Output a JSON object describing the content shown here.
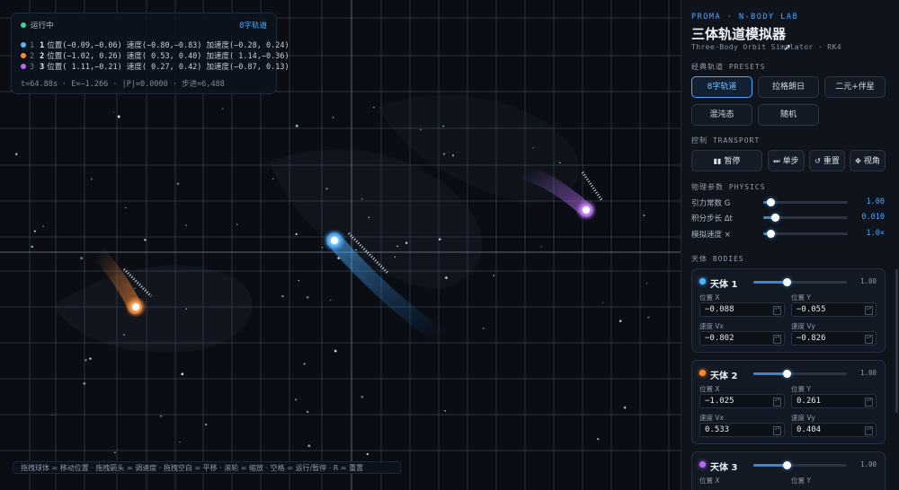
{
  "hud": {
    "status": "运行中",
    "preset": "8字轨道",
    "bodies": [
      {
        "idx": "1",
        "color": "#4fb6ff",
        "text": "位置(−0.09,−0.06) 速度(−0.80,−0.83) 加速度(−0.28, 0.24)"
      },
      {
        "idx": "2",
        "color": "#ff8a2e",
        "text": "位置(−1.02, 0.26) 速度( 0.53, 0.40) 加速度( 1.14,−0.36)"
      },
      {
        "idx": "3",
        "color": "#b56cf2",
        "text": "位置( 1.11,−0.21) 速度( 0.27, 0.42) 加速度(−0.87, 0.13)"
      }
    ],
    "stats": "t=64.88s · E=−1.266 · |P|=0.0000 · 步进=6,488"
  },
  "hint": "拖拽球体 = 移动位置 · 拖拽箭头 = 调速度 · 拖拽空白 = 平移 · 滚轮 = 缩放 · 空格 = 运行/暂停 · R = 重置",
  "panel": {
    "brand": "PROMA · N-BODY LAB",
    "title": "三体轨道模拟器",
    "subtitle": "Three-Body Orbit Simulator · RK4",
    "presets_label": "经典轨道 PRESETS",
    "presets": [
      "8字轨道",
      "拉格朗日",
      "二元+伴星",
      "混沌态",
      "随机"
    ],
    "transport_label": "控制 TRANSPORT",
    "transport": [
      {
        "icon": "▮▮",
        "label": "暂停"
      },
      {
        "icon": "⏭",
        "label": "单步"
      },
      {
        "icon": "↺",
        "label": "重置"
      },
      {
        "icon": "✥",
        "label": "视角"
      }
    ],
    "physics_label": "物理参数 PHYSICS",
    "params": [
      {
        "label": "引力常数 G",
        "value": "1.00",
        "level": 0.05
      },
      {
        "label": "积分步长 Δt",
        "value": "0.010",
        "level": 0.1
      },
      {
        "label": "模拟速度 ×",
        "value": "1.0×",
        "level": 0.05
      }
    ],
    "bodies_label": "天体 BODIES",
    "bodies": [
      {
        "name": "天体 1",
        "color": "#4fb6ff",
        "mass": "1.00",
        "mass_level": 0.35,
        "pos_x_label": "位置 X",
        "pos_y_label": "位置 Y",
        "vel_x_label": "速度 Vx",
        "vel_y_label": "速度 Vy",
        "x": "−0.088",
        "y": "−0.055",
        "vx": "−0.802",
        "vy": "−0.826"
      },
      {
        "name": "天体 2",
        "color": "#ff8a2e",
        "mass": "1.00",
        "mass_level": 0.35,
        "pos_x_label": "位置 X",
        "pos_y_label": "位置 Y",
        "vel_x_label": "速度 Vx",
        "vel_y_label": "速度 Vy",
        "x": "−1.025",
        "y": "0.261",
        "vx": "0.533",
        "vy": "0.404"
      },
      {
        "name": "天体 3",
        "color": "#b56cf2",
        "mass": "1.00",
        "mass_level": 0.35,
        "pos_x_label": "位置 X",
        "pos_y_label": "位置 Y"
      }
    ]
  }
}
